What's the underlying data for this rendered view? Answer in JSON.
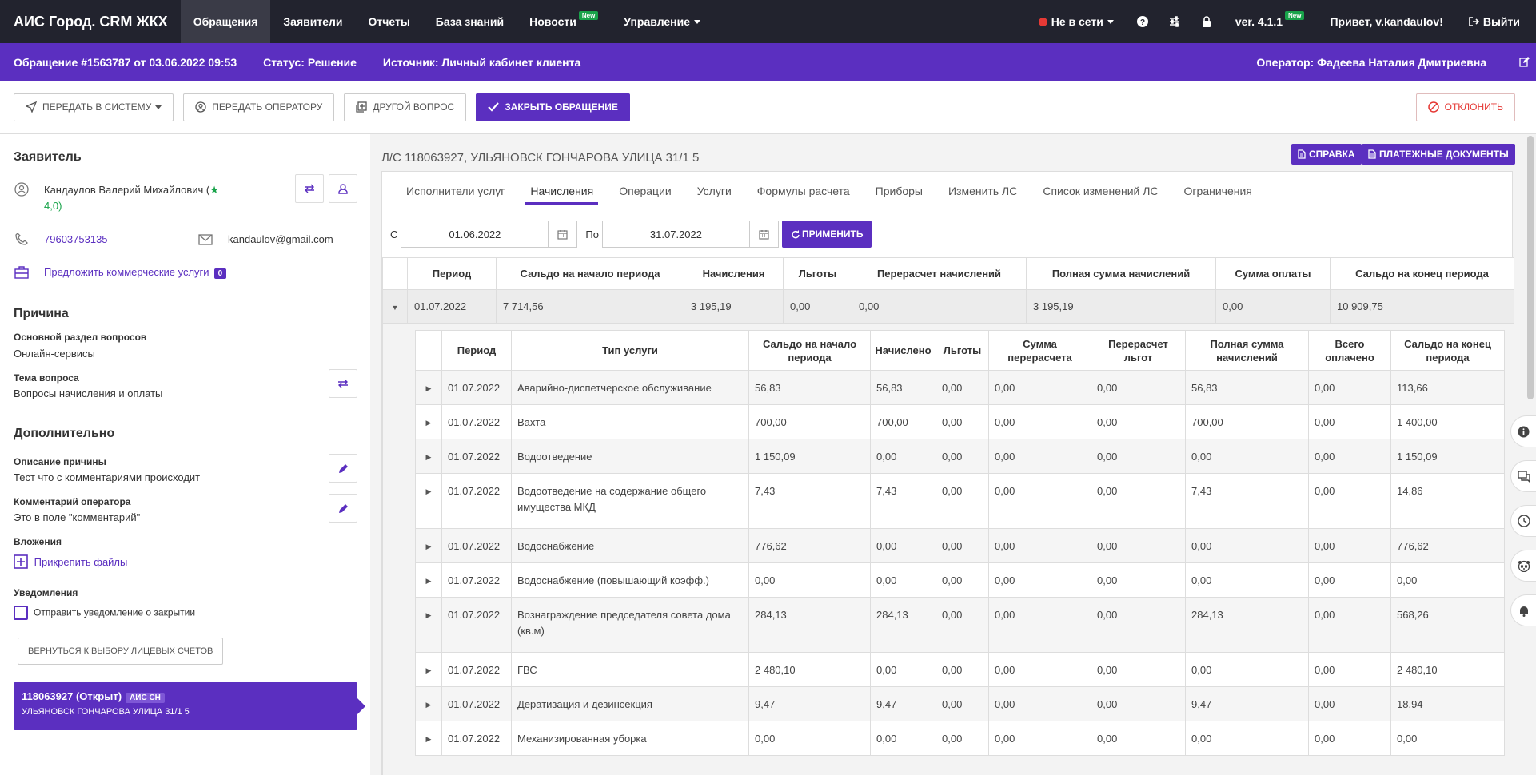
{
  "navbar": {
    "brand": "АИС Город. CRM ЖКХ",
    "items": [
      {
        "label": "Обращения",
        "active": true
      },
      {
        "label": "Заявители"
      },
      {
        "label": "Отчеты"
      },
      {
        "label": "База знаний"
      },
      {
        "label": "Новости",
        "badge": "New"
      },
      {
        "label": "Управление"
      }
    ],
    "status": "Не в сети",
    "version": "ver. 4.1.1",
    "version_badge": "New",
    "greeting": "Привет, v.kandaulov!",
    "logout": "Выйти"
  },
  "infobar": {
    "ticket": "Обращение #1563787 от 03.06.2022 09:53",
    "status": "Статус: Решение",
    "source": "Источник: Личный кабинет клиента",
    "operator": "Оператор: Фадеева Наталия Дмитриевна"
  },
  "toolbar": {
    "transfer_system": "Передать в систему",
    "transfer_operator": "Передать оператору",
    "other_question": "Другой вопрос",
    "close_ticket": "Закрыть обращение",
    "reject": "Отклонить"
  },
  "applicant": {
    "title": "Заявитель",
    "name": "Кандаулов Валерий Михайлович (",
    "rating": "4,0)",
    "phone": "79603753135",
    "email": "kandaulov@gmail.com",
    "offer": "Предложить коммерческие услуги",
    "offer_count": "0"
  },
  "reason": {
    "title": "Причина",
    "section_label": "Основной раздел вопросов",
    "section_value": "Онлайн-сервисы",
    "topic_label": "Тема вопроса",
    "topic_value": "Вопросы начисления и оплаты"
  },
  "additional": {
    "title": "Дополнительно",
    "desc_label": "Описание причины",
    "desc_value": "Тест что с комментариями происходит",
    "comment_label": "Комментарий оператора",
    "comment_value": "Это в поле \"комментарий\"",
    "attach_label": "Вложения",
    "attach_link": "Прикрепить файлы",
    "notify_label": "Уведомления",
    "notify_check": "Отправить уведомление о закрытии",
    "back_button": "Вернуться к выбору лицевых счетов"
  },
  "account_card": {
    "title": "118063927 (Открыт)",
    "badge": "АИС СН",
    "address": "УЛЬЯНОВСК ГОНЧАРОВА УЛИЦА 31/1 5"
  },
  "main": {
    "ls_title": "Л/С 118063927, УЛЬЯНОВСК ГОНЧАРОВА УЛИЦА 31/1 5",
    "btn_help": "Справка",
    "btn_payments": "Платежные документы",
    "tabs": [
      "Исполнители услуг",
      "Начисления",
      "Операции",
      "Услуги",
      "Формулы расчета",
      "Приборы",
      "Изменить ЛС",
      "Список изменений ЛС",
      "Ограничения"
    ],
    "date_from_label": "С",
    "date_from": "01.06.2022",
    "date_to_label": "По",
    "date_to": "31.07.2022",
    "apply": "Применить"
  },
  "summary_table": {
    "headers": [
      "Период",
      "Сальдо на начало периода",
      "Начисления",
      "Льготы",
      "Перерасчет начислений",
      "Полная сумма начислений",
      "Сумма оплаты",
      "Сальдо на конец периода"
    ],
    "row": [
      "01.07.2022",
      "7 714,56",
      "3 195,19",
      "0,00",
      "0,00",
      "3 195,19",
      "0,00",
      "10 909,75"
    ]
  },
  "detail_table": {
    "headers": [
      "Период",
      "Тип услуги",
      "Сальдо на начало периода",
      "Начислено",
      "Льготы",
      "Сумма перерасчета",
      "Перерасчет льгот",
      "Полная сумма начислений",
      "Всего оплачено",
      "Сальдо на конец периода"
    ],
    "rows": [
      [
        "01.07.2022",
        "Аварийно-диспетчерское обслуживание",
        "56,83",
        "56,83",
        "0,00",
        "0,00",
        "0,00",
        "56,83",
        "0,00",
        "113,66"
      ],
      [
        "01.07.2022",
        "Вахта",
        "700,00",
        "700,00",
        "0,00",
        "0,00",
        "0,00",
        "700,00",
        "0,00",
        "1 400,00"
      ],
      [
        "01.07.2022",
        "Водоотведение",
        "1 150,09",
        "0,00",
        "0,00",
        "0,00",
        "0,00",
        "0,00",
        "0,00",
        "1 150,09"
      ],
      [
        "01.07.2022",
        "Водоотведение на содержание общего имущества МКД",
        "7,43",
        "7,43",
        "0,00",
        "0,00",
        "0,00",
        "7,43",
        "0,00",
        "14,86"
      ],
      [
        "01.07.2022",
        "Водоснабжение",
        "776,62",
        "0,00",
        "0,00",
        "0,00",
        "0,00",
        "0,00",
        "0,00",
        "776,62"
      ],
      [
        "01.07.2022",
        "Водоснабжение (повышающий коэфф.)",
        "0,00",
        "0,00",
        "0,00",
        "0,00",
        "0,00",
        "0,00",
        "0,00",
        "0,00"
      ],
      [
        "01.07.2022",
        "Вознаграждение председателя совета дома (кв.м)",
        "284,13",
        "284,13",
        "0,00",
        "0,00",
        "0,00",
        "284,13",
        "0,00",
        "568,26"
      ],
      [
        "01.07.2022",
        "ГВС",
        "2 480,10",
        "0,00",
        "0,00",
        "0,00",
        "0,00",
        "0,00",
        "0,00",
        "2 480,10"
      ],
      [
        "01.07.2022",
        "Дератизация и дезинсекция",
        "9,47",
        "9,47",
        "0,00",
        "0,00",
        "0,00",
        "9,47",
        "0,00",
        "18,94"
      ],
      [
        "01.07.2022",
        "Механизированная уборка",
        "0,00",
        "0,00",
        "0,00",
        "0,00",
        "0,00",
        "0,00",
        "0,00",
        "0,00"
      ]
    ]
  },
  "colors": {
    "primary": "#5b2fc0",
    "navbar": "#22232e",
    "danger": "#e53935",
    "success": "#18a34a"
  }
}
